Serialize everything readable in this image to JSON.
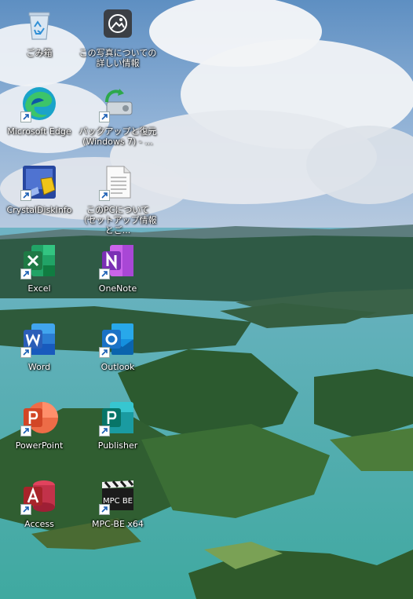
{
  "desktop": {
    "icons": [
      {
        "label": "ごみ箱",
        "icon": "recycle-bin-icon"
      },
      {
        "label": "この写真についての詳しい情報",
        "icon": "photo-info-icon"
      },
      {
        "label": "Microsoft Edge",
        "icon": "edge-icon"
      },
      {
        "label": "バックアップと復元 (Windows 7) - ...",
        "icon": "backup-restore-icon"
      },
      {
        "label": "CrystalDiskInfo",
        "icon": "crystaldiskinfo-icon"
      },
      {
        "label": "このPCについて（セットアップ情報とご...",
        "icon": "document-icon"
      },
      {
        "label": "Excel",
        "icon": "excel-icon"
      },
      {
        "label": "OneNote",
        "icon": "onenote-icon"
      },
      {
        "label": "Word",
        "icon": "word-icon"
      },
      {
        "label": "Outlook",
        "icon": "outlook-icon"
      },
      {
        "label": "PowerPoint",
        "icon": "powerpoint-icon"
      },
      {
        "label": "Publisher",
        "icon": "publisher-icon"
      },
      {
        "label": "Access",
        "icon": "access-icon"
      },
      {
        "label": "MPC-BE x64",
        "icon": "mpc-be-icon"
      }
    ],
    "mpc_text": "MPC BE",
    "colors": {
      "excel": "#1f7a45",
      "onenote": "#7b2fb5",
      "word": "#2b5eb8",
      "outlook": "#1b72c6",
      "powerpoint": "#d24626",
      "publisher": "#077568",
      "access": "#a8242a",
      "edge": "#1aa3c9"
    }
  }
}
